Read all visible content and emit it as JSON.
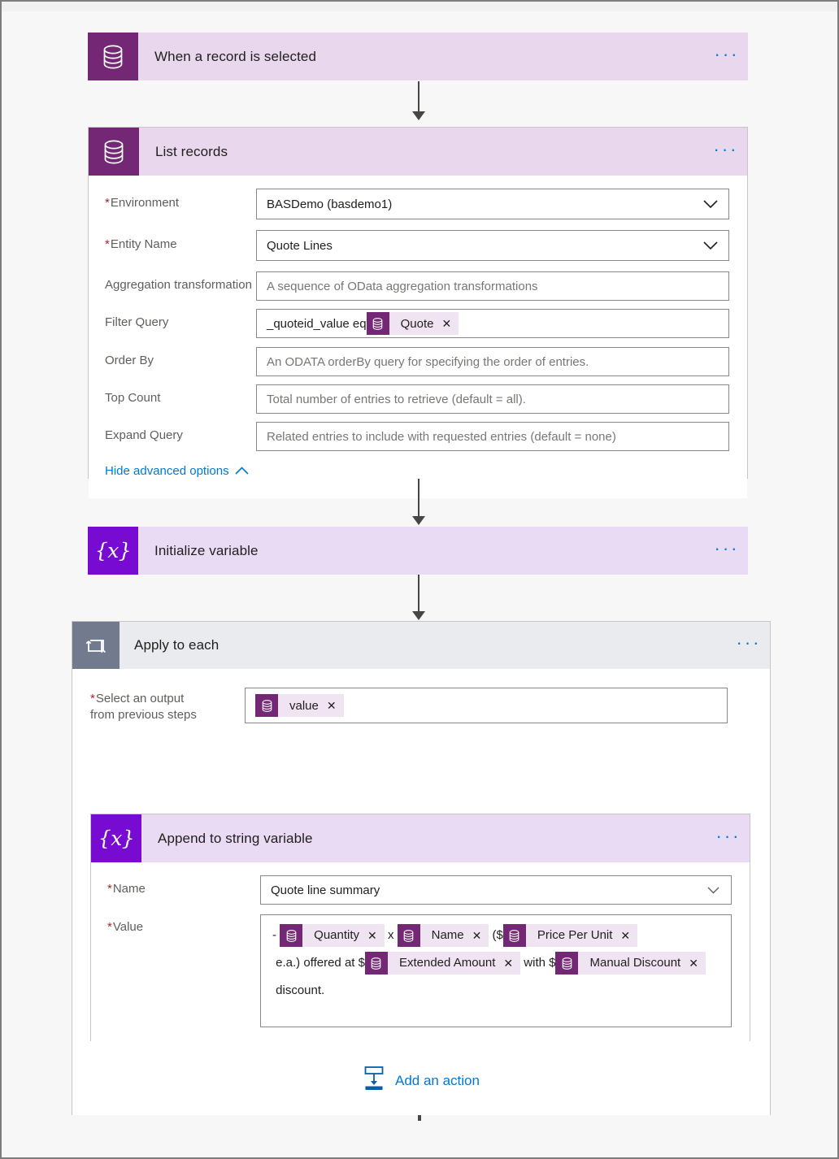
{
  "flow": {
    "steps": [
      {
        "id": "trigger",
        "title": "When a record is selected",
        "icon": "dataverse-database-icon",
        "menu": "···"
      },
      {
        "id": "list-records",
        "title": "List records",
        "icon": "dataverse-database-icon",
        "menu": "···",
        "fields": [
          {
            "label": "Environment",
            "required": true,
            "value": "BASDemo (basdemo1)",
            "control": "dropdown"
          },
          {
            "label": "Entity Name",
            "required": true,
            "value": "Quote Lines",
            "control": "dropdown"
          },
          {
            "label": "Aggregation transformation",
            "required": false,
            "placeholder": "A sequence of OData aggregation transformations",
            "control": "text"
          },
          {
            "label": "Filter Query",
            "required": false,
            "control": "token",
            "prefix": "_quoteid_value eq ",
            "token": "Quote"
          },
          {
            "label": "Order By",
            "required": false,
            "placeholder": "An ODATA orderBy query for specifying the order of entries.",
            "control": "text"
          },
          {
            "label": "Top Count",
            "required": false,
            "placeholder": "Total number of entries to retrieve (default = all).",
            "control": "text"
          },
          {
            "label": "Expand Query",
            "required": false,
            "placeholder": "Related entries to include with requested entries (default = none)",
            "control": "text"
          }
        ],
        "advanced_link": "Hide advanced options"
      },
      {
        "id": "initialize-variable",
        "title": "Initialize variable",
        "icon": "variable-braces-icon",
        "menu": "···"
      },
      {
        "id": "apply-to-each",
        "title": "Apply to each",
        "icon": "loop-arrow-icon",
        "menu": "···",
        "select_output": {
          "label_line1": "Select an output",
          "label_line2": "from previous steps",
          "required": true,
          "token": "value"
        },
        "child": {
          "id": "append-to-string-variable",
          "title": "Append to string variable",
          "icon": "variable-braces-icon",
          "menu": "···",
          "name_field": {
            "label": "Name",
            "required": true,
            "value": "Quote line summary",
            "control": "dropdown"
          },
          "value_field": {
            "label": "Value",
            "required": true,
            "segments": [
              {
                "kind": "text",
                "text": "- "
              },
              {
                "kind": "token",
                "text": "Quantity"
              },
              {
                "kind": "text",
                "text": " x "
              },
              {
                "kind": "token",
                "text": "Name"
              },
              {
                "kind": "text",
                "text": " ($"
              },
              {
                "kind": "token",
                "text": "Price Per Unit"
              },
              {
                "kind": "text",
                "text": " e.a.) offered at $"
              },
              {
                "kind": "token",
                "text": "Extended Amount"
              },
              {
                "kind": "text",
                "text": " with $"
              },
              {
                "kind": "token",
                "text": "Manual Discount"
              },
              {
                "kind": "text",
                "text": " discount."
              }
            ]
          }
        },
        "add_action": {
          "label": "Add an action",
          "icon": "add-action-icon"
        }
      }
    ]
  },
  "theme": {
    "dataverse_purple": "#742774",
    "variable_violet": "#770bd2",
    "loop_grey": "#717b8d",
    "header_lilac": "#e8d7ed",
    "header_grey": "#e9ebee",
    "link_blue": "#0078d4",
    "required_red": "#a4262c",
    "token_bg": "#f0e4f3",
    "canvas_bg": "#f7f7f7"
  },
  "token_remove_glyph": "✕"
}
